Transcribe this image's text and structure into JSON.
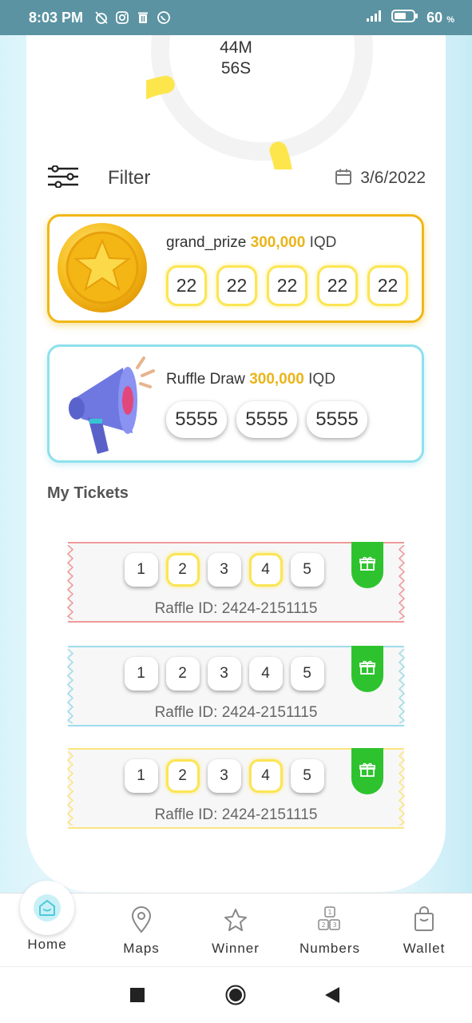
{
  "status_bar": {
    "time": "8:03 PM",
    "battery": "60",
    "battery_unit": "%"
  },
  "timer": {
    "minutes": "44M",
    "seconds": "56S",
    "progress_fraction": 0.78
  },
  "filter": {
    "label": "Filter",
    "date": "3/6/2022"
  },
  "grand_prize": {
    "name": "grand_prize",
    "amount": "300,000",
    "currency": "IQD",
    "numbers": [
      "22",
      "22",
      "22",
      "22",
      "22"
    ]
  },
  "ruffle_draw": {
    "name": "Ruffle Draw",
    "amount": "300,000",
    "currency": "IQD",
    "numbers": [
      "5555",
      "5555",
      "5555"
    ]
  },
  "my_tickets": {
    "title": "My Tickets",
    "tickets": [
      {
        "numbers": [
          "1",
          "2",
          "3",
          "4",
          "5"
        ],
        "raffle_id": "Raffle ID: 2424-2151115",
        "color": "#ef9a9a"
      },
      {
        "numbers": [
          "1",
          "2",
          "3",
          "4",
          "5"
        ],
        "raffle_id": "Raffle ID: 2424-2151115",
        "color": "#9edcea"
      },
      {
        "numbers": [
          "1",
          "2",
          "3",
          "4",
          "5"
        ],
        "raffle_id": "Raffle ID: 2424-2151115",
        "color": "#fbe580"
      }
    ]
  },
  "bottom_nav": {
    "home": "Home",
    "maps": "Maps",
    "winner": "Winner",
    "numbers": "Numbers",
    "wallet": "Wallet"
  },
  "colors": {
    "accent_gold": "#f0b716",
    "accent_blue": "#8ee0ec",
    "gift_green": "#2ec32e",
    "status_bar": "#5b93a2"
  }
}
